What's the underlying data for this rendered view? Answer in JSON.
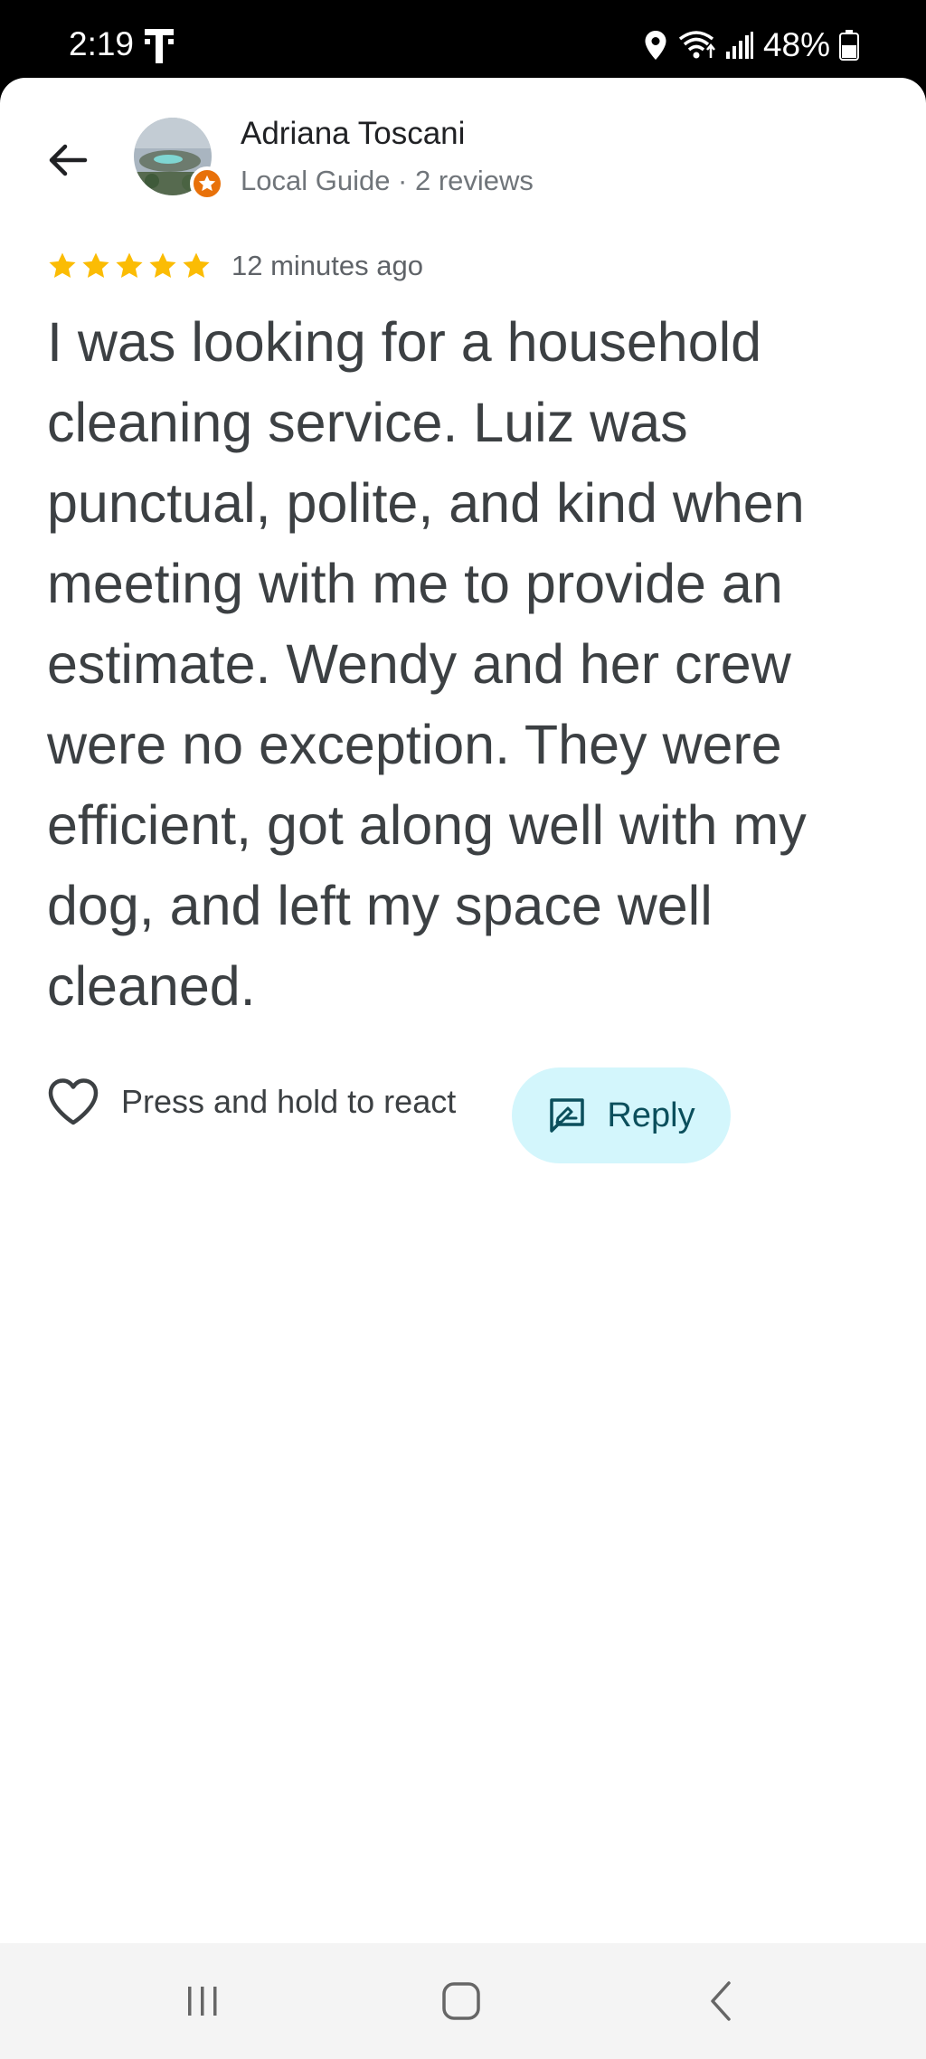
{
  "status_bar": {
    "time": "2:19",
    "battery": "48%",
    "icons": [
      "t-mobile-icon",
      "location-icon",
      "wifi-icon",
      "signal-icon",
      "battery-icon"
    ]
  },
  "review": {
    "author": "Adriana Toscani",
    "meta": "Local Guide · 2 reviews",
    "rating": 5,
    "rating_max": 5,
    "time": "12 minutes ago",
    "text": "I was looking for a household cleaning service. Luiz was punctual, polite, and kind when meeting with me to provide an estimate. Wendy and her crew were no exception. They were efficient, got along well with my dog, and left my space well cleaned."
  },
  "actions": {
    "react_label": "Press and hold to react",
    "reply_label": "Reply"
  },
  "colors": {
    "star": "#fbbc04",
    "badge": "#e8710a",
    "reply_bg": "#d3f6fc",
    "reply_text": "#0b4f5c",
    "text_primary": "#202124",
    "text_secondary": "#70757a"
  },
  "nav": {
    "buttons": [
      "recent-apps",
      "home",
      "back"
    ]
  }
}
